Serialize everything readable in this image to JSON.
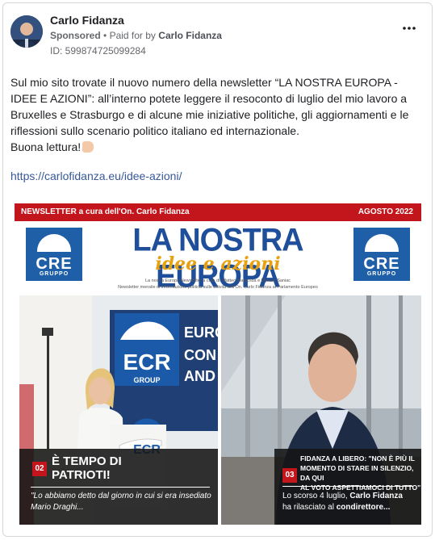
{
  "ad": {
    "advertiser": "Carlo Fidanza",
    "sponsored": "Sponsored",
    "separator": "•",
    "paid_for_by": "Paid for by",
    "payer": "Carlo Fidanza",
    "ad_id": "ID: 599874725099284",
    "more_icon": "more-options-icon"
  },
  "text": {
    "paragraph": "Sul mio sito trovate il nuovo numero della newsletter “LA NOSTRA EUROPA - IDEE E AZIONI”: all’interno potete leggere il resoconto di luglio del mio lavoro a Bruxelles e Strasburgo e di alcune mie iniziative politiche, gli aggiornamenti e le riflessioni sullo scenario politico italiano ed internazionale.",
    "closing": "Buona lettura!",
    "closing_icon": "pointing-down-hand-icon",
    "link": "https://carlofidanza.eu/idee-azioni/"
  },
  "creative": {
    "banner_left": "NEWSLETTER a cura dell'On. Carlo Fidanza",
    "banner_right": "AGOSTO 2022",
    "logo_text": "CRE",
    "logo_sub": "GRUPPO",
    "title": "LA NOSTRA EUROPA",
    "subtitle": "idee e azioni",
    "credits_1": "La nostra Europa Newsletter a cura di: Matteo Malacrida e Myriam Saniac",
    "credits_2": "Newsletter mensile di informazione politica sulle attività dell'On. Carlo Fidanza al Parlamento Europeo",
    "left": {
      "sign_1": "EURO",
      "sign_2": "CON",
      "sign_3": "AND",
      "ecr_text": "ECR",
      "ecr_sub": "GROUP",
      "number": "02",
      "title_1": "È TEMPO DI",
      "title_2": "PATRIOTI!",
      "text": "\"Lo abbiamo detto dal giorno in cui si era insediato Mario Draghi..."
    },
    "right": {
      "number": "03",
      "title_1": "FIDANZA A LIBERO: \"NON È PIÙ IL",
      "title_2": "MOMENTO DI STARE IN SILENZIO, DA QUI",
      "title_3": "AL VOTO ASPETTIAMOCI DI TUTTO\"",
      "text_1": "Lo scorso 4 luglio,",
      "text_name": "Carlo Fidanza",
      "text_2": "ha rilasciato al",
      "text_bold": "condirettore..."
    }
  },
  "colors": {
    "brand_red": "#c3151c",
    "cre_blue": "#1f5fa8",
    "title_blue": "#1f4f9a",
    "subtitle_gold": "#e8a10f",
    "link": "#385898"
  }
}
